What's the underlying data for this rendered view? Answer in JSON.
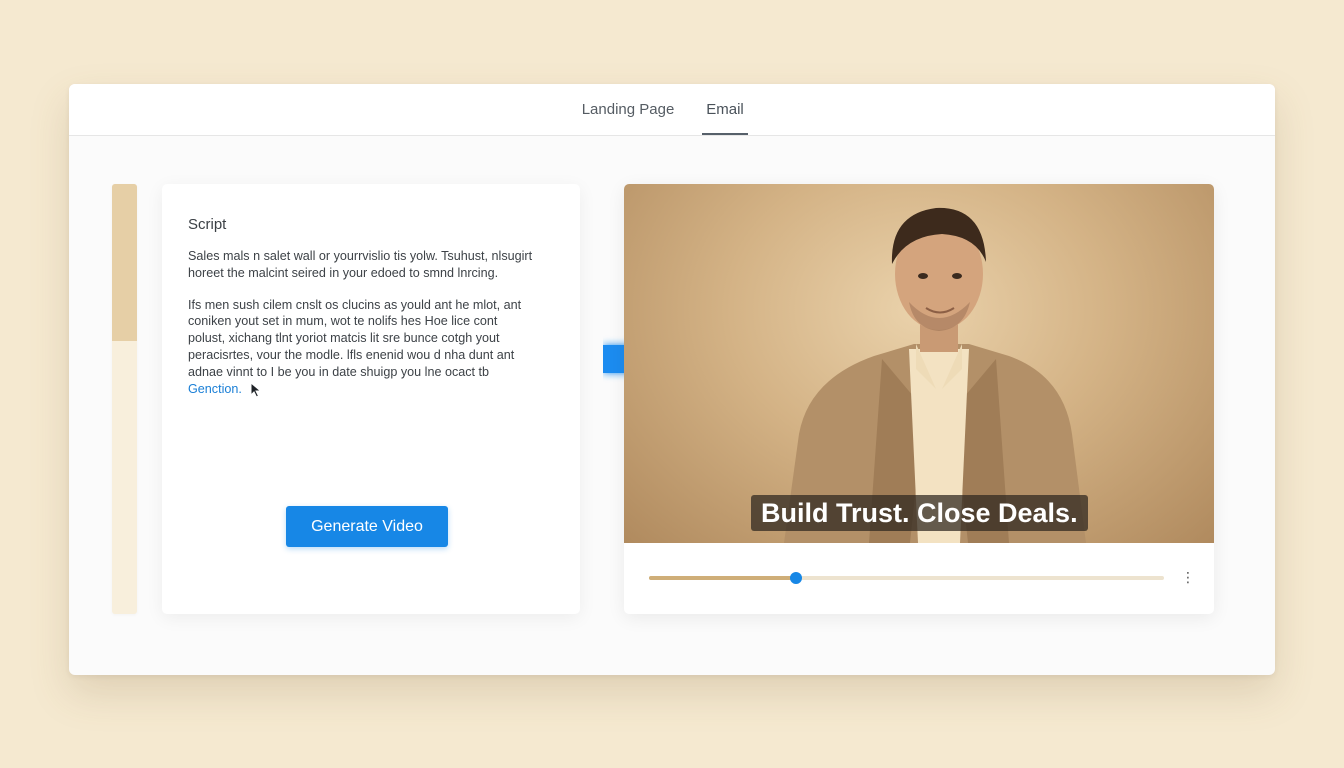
{
  "tabs": [
    {
      "label": "Landing Page",
      "active": false
    },
    {
      "label": "Email",
      "active": true
    }
  ],
  "script": {
    "title": "Script",
    "paragraph_1": "Sales mals n salet wall or yourrvislio tis yolw. Tsuhust, nlsugirt\nhoreet the malcint seired in your edoed to smnd lnrcing.",
    "paragraph_2": "Ifs men sush cilem cnslt os clucins as yould ant he mlot, ant\nconiken yout set in mum, wot te nolifs hes Hoe lice cont\npolust, xichang tlnt yoriot matcis lit sre bunce cotgh yout\nperacisrtes, vour the modle. lfls enenid wou d nha dunt ant\nadnae vinnt to I be you in date shuigp you lne ocact tb",
    "link_text": "Genction.",
    "generate_button": "Generate Video"
  },
  "video": {
    "caption": "Build Trust. Close Deals.",
    "progress": 0.285,
    "more_icon": "⋮"
  },
  "icons": {
    "arrow": "arrow-right-icon",
    "cursor": "mouse-cursor-icon",
    "more": "more-vertical-icon"
  },
  "colors": {
    "accent": "#1787e6",
    "background": "#f5e9d0",
    "seek_fill": "#cfae78"
  }
}
